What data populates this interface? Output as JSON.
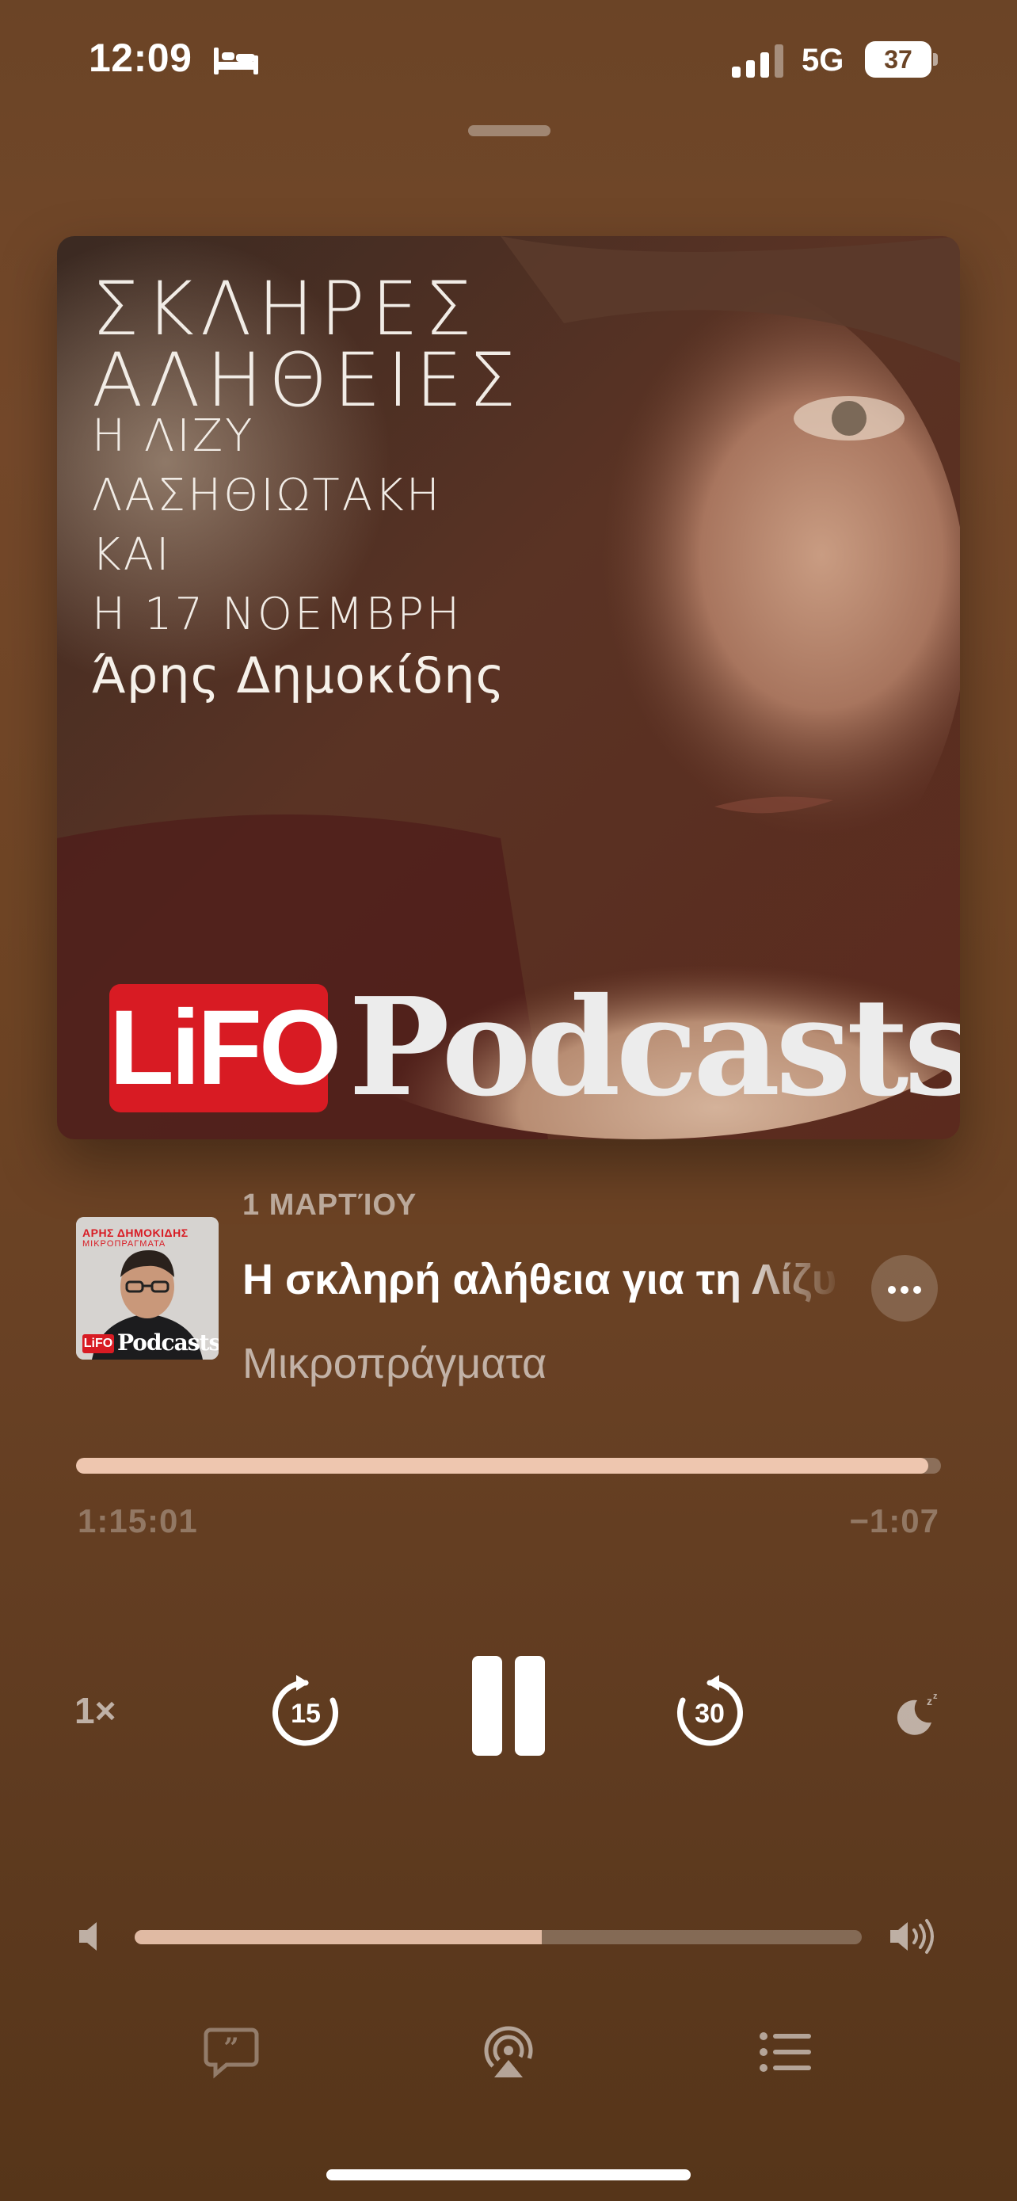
{
  "status_bar": {
    "time": "12:09",
    "network": "5G",
    "battery": "37"
  },
  "artwork": {
    "title_lines": [
      "ΣΚΛΗΡΕΣ",
      "ΑΛΗΘΕΙΕΣ"
    ],
    "subtitle_lines": [
      "Η ΛΙΖΥ",
      "ΛΑΣΗΘΙΩΤΑΚΗ",
      "ΚΑΙ",
      "Η 17 ΝΟΕΜΒΡΗ"
    ],
    "author": "Άρης Δημοκίδης",
    "logo_text": "LiFO",
    "podcasts_word": "Podcasts"
  },
  "thumbnail": {
    "author": "ΑΡΗΣ ΔΗΜΟΚΙΔΗΣ",
    "show": "ΜΙΚΡΟΠΡΑΓΜΑΤΑ",
    "logo_text": "LiFO",
    "podcasts_word": "Podcasts"
  },
  "episode": {
    "date": "1 ΜΑΡΤΊΟΥ",
    "title": "Η σκληρή αλήθεια για τη Λίζυ Λασηθιωτάκη και",
    "show": "Μικροπράγματα"
  },
  "progress": {
    "elapsed": "1:15:01",
    "remaining": "−1:07",
    "fraction": 0.985
  },
  "controls": {
    "speed": "1×",
    "skip_back_seconds": "15",
    "skip_forward_seconds": "30"
  },
  "volume": {
    "level": 0.56
  },
  "icons": {
    "lyrics": "quote-bubble-icon",
    "airplay": "airplay-audio-icon",
    "queue": "list-icon"
  },
  "colors": {
    "background": "#6b4426",
    "progress_fill": "#ffd6be",
    "logo_red": "#d81b23"
  }
}
